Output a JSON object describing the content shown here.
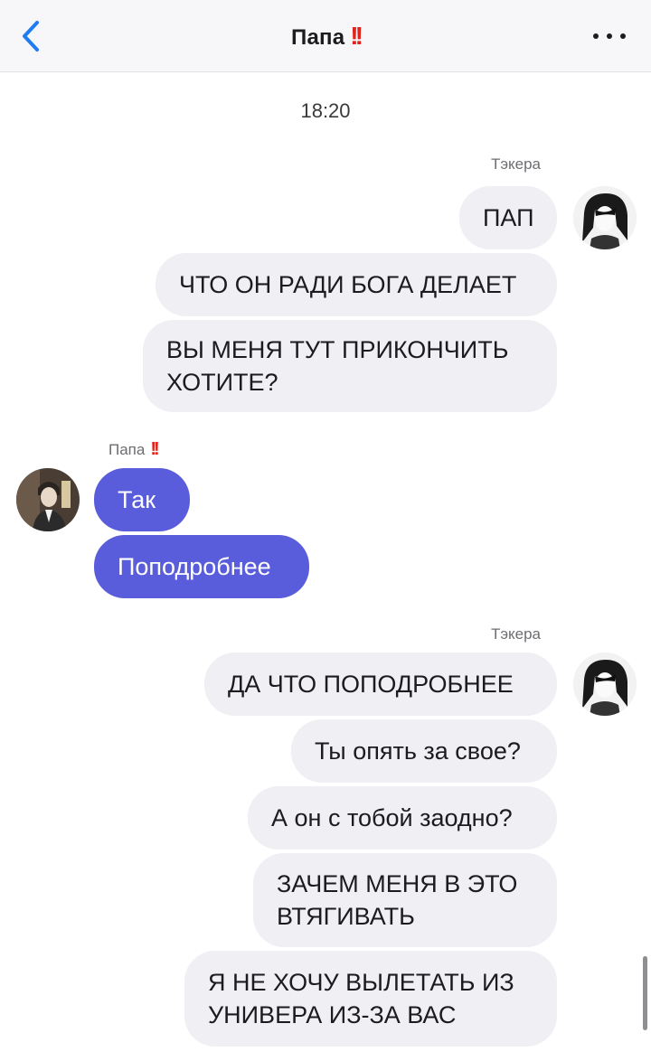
{
  "header": {
    "title": "Папа",
    "title_mark": "!!",
    "back_icon": "chevron-left-icon",
    "more_icon": "more-horizontal-icon",
    "accent_color": "#1f7cf2"
  },
  "timestamp": "18:20",
  "groups": [
    {
      "sender": "Тэкера",
      "messages": [
        "ПАП",
        "ЧТО ОН РАДИ БОГА ДЕЛАЕТ",
        "ВЫ МЕНЯ ТУТ ПРИКОНЧИТЬ\nХОТИТЕ?"
      ]
    },
    {
      "sender": "Папа",
      "sender_mark": "!!",
      "messages": [
        "Так",
        "Поподробнее"
      ]
    },
    {
      "sender": "Тэкера",
      "messages": [
        "ДА ЧТО ПОПОДРОБНЕЕ",
        "Ты опять за свое?",
        "А он с тобой заодно?",
        "ЗАЧЕМ МЕНЯ В ЭТО\nВТЯГИВАТЬ",
        "Я НЕ ХОЧУ ВЫЛЕТАТЬ ИЗ\nУНИВЕРА ИЗ-ЗА ВАС"
      ]
    }
  ],
  "colors": {
    "incoming_bubble": "#5a5ddb",
    "outgoing_bubble": "#efeff4",
    "alert_mark": "#e0231b"
  }
}
